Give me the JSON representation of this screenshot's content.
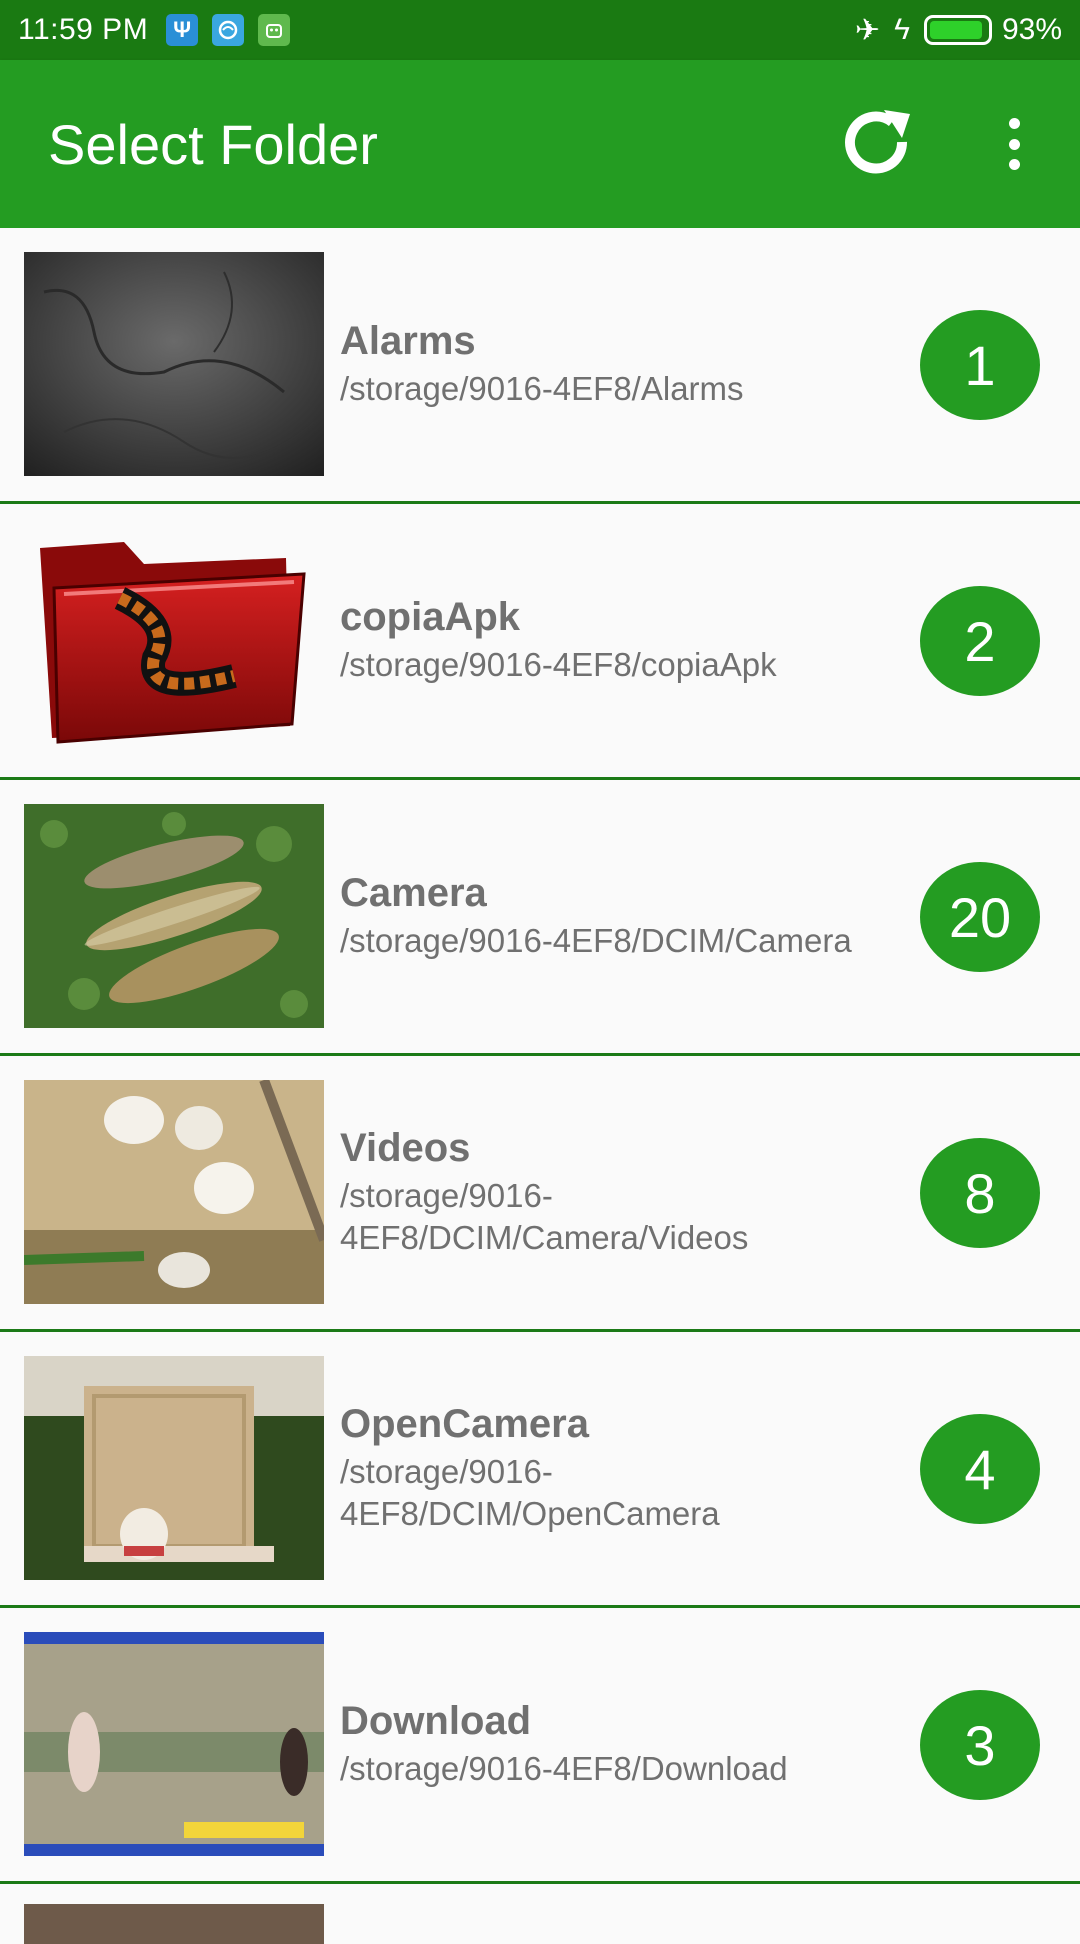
{
  "status_bar": {
    "time": "11:59 PM",
    "battery": "93%",
    "battery_level": 0.93,
    "icons": [
      "usb-icon",
      "swiftkey-icon",
      "android-bot-icon",
      "airplane-icon",
      "charging-icon",
      "battery-icon"
    ]
  },
  "app_bar": {
    "title": "Select Folder",
    "actions": [
      "refresh-icon",
      "more-options-icon"
    ]
  },
  "folders": [
    {
      "name": "Alarms",
      "path": "/storage/9016-4EF8/Alarms",
      "count": "1",
      "thumb": "dark stone texture"
    },
    {
      "name": "copiaApk",
      "path": "/storage/9016-4EF8/copiaApk",
      "count": "2",
      "thumb": "red video folder icon"
    },
    {
      "name": "Camera",
      "path": "/storage/9016-4EF8/DCIM/Camera",
      "count": "20",
      "thumb": "fish on grass"
    },
    {
      "name": "Videos",
      "path": "/storage/9016-4EF8/DCIM/Camera/Videos",
      "count": "8",
      "thumb": "white rabbits"
    },
    {
      "name": "OpenCamera",
      "path": "/storage/9016-4EF8/DCIM/OpenCamera",
      "count": "4",
      "thumb": "chicken coop on grass"
    },
    {
      "name": "Download",
      "path": "/storage/9016-4EF8/Download",
      "count": "3",
      "thumb": "people on field"
    }
  ],
  "colors": {
    "status_bar": "#1a7a12",
    "app_bar": "#249c22",
    "badge": "#249c22",
    "divider": "#1b7a17",
    "text_secondary": "#707070"
  }
}
